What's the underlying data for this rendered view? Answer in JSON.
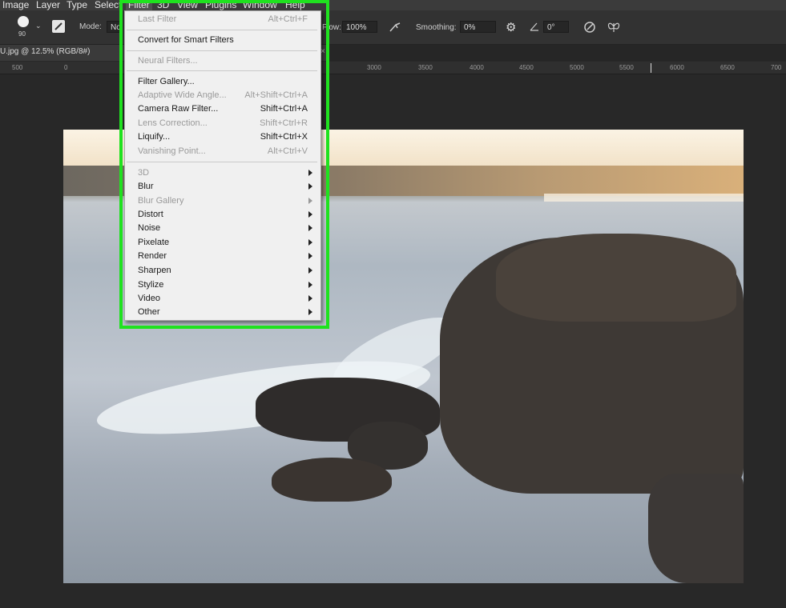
{
  "menubar": {
    "items": [
      "Image",
      "Layer",
      "Type",
      "Select",
      "Filter",
      "3D",
      "View",
      "Plugins",
      "Window",
      "Help"
    ],
    "active": "Filter"
  },
  "options": {
    "brush_size": "90",
    "mode_label": "Mode:",
    "mode_value": "No",
    "flow_label": "Flow:",
    "flow_value": "100%",
    "smoothing_label": "Smoothing:",
    "smoothing_value": "0%",
    "angle_value": "0°"
  },
  "tab": {
    "title": "U.jpg @ 12.5% (RGB/8#)"
  },
  "ruler": {
    "ticks": [
      "500",
      "0",
      "3000",
      "3500",
      "4000",
      "4500",
      "5000",
      "5500",
      "6000",
      "6500",
      "700"
    ]
  },
  "filter_menu": {
    "items": [
      {
        "label": "Last Filter",
        "shortcut": "Alt+Ctrl+F",
        "disabled": true
      },
      {
        "label": "Convert for Smart Filters",
        "shortcut": "",
        "disabled": false
      },
      {
        "label": "Neural Filters...",
        "shortcut": "",
        "disabled": true
      },
      {
        "label": "Filter Gallery...",
        "shortcut": "",
        "disabled": false
      },
      {
        "label": "Adaptive Wide Angle...",
        "shortcut": "Alt+Shift+Ctrl+A",
        "disabled": true
      },
      {
        "label": "Camera Raw Filter...",
        "shortcut": "Shift+Ctrl+A",
        "disabled": false
      },
      {
        "label": "Lens Correction...",
        "shortcut": "Shift+Ctrl+R",
        "disabled": true
      },
      {
        "label": "Liquify...",
        "shortcut": "Shift+Ctrl+X",
        "disabled": false
      },
      {
        "label": "Vanishing Point...",
        "shortcut": "Alt+Ctrl+V",
        "disabled": true
      },
      {
        "label": "3D",
        "submenu": true,
        "disabled": true
      },
      {
        "label": "Blur",
        "submenu": true,
        "disabled": false
      },
      {
        "label": "Blur Gallery",
        "submenu": true,
        "disabled": true
      },
      {
        "label": "Distort",
        "submenu": true,
        "disabled": false
      },
      {
        "label": "Noise",
        "submenu": true,
        "disabled": false
      },
      {
        "label": "Pixelate",
        "submenu": true,
        "disabled": false
      },
      {
        "label": "Render",
        "submenu": true,
        "disabled": false
      },
      {
        "label": "Sharpen",
        "submenu": true,
        "disabled": false
      },
      {
        "label": "Stylize",
        "submenu": true,
        "disabled": false
      },
      {
        "label": "Video",
        "submenu": true,
        "disabled": false
      },
      {
        "label": "Other",
        "submenu": true,
        "disabled": false
      }
    ]
  },
  "colors": {
    "highlight": "#1fe21f",
    "menu_bg": "#f0f0f0",
    "workspace": "#282828"
  }
}
